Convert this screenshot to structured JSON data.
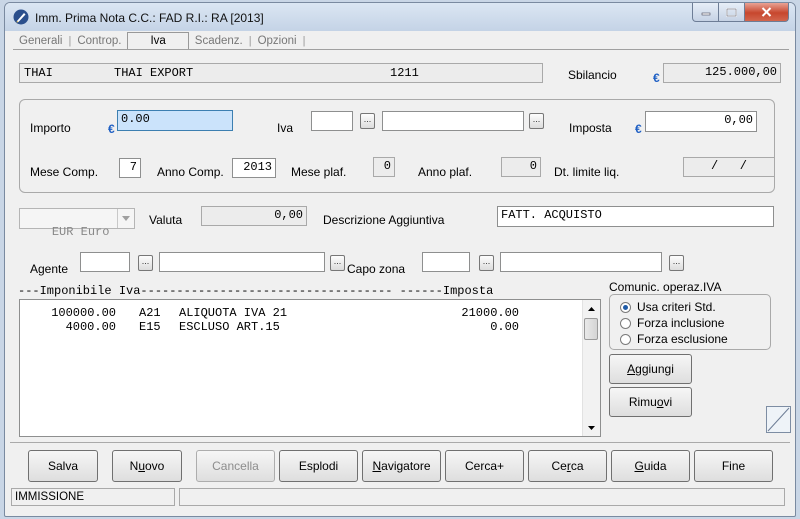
{
  "window": {
    "title": "Imm. Prima Nota C.C.: FAD  R.I.: RA  [2013]",
    "accent": "#1e5fc4",
    "close_color": "#c7472e"
  },
  "tabs": [
    {
      "label": "Generali",
      "active": false
    },
    {
      "label": "Controp.",
      "active": false
    },
    {
      "label": "Iva",
      "active": true
    },
    {
      "label": "Scadenz.",
      "active": false
    },
    {
      "label": "Opzioni",
      "active": false
    }
  ],
  "tab_separator": "|",
  "header": {
    "code": "THAI",
    "name": "THAI EXPORT",
    "number": "1211",
    "sbilancio_label": "Sbilancio",
    "currency_symbol": "€",
    "sbilancio_value": "125.000,00"
  },
  "iva_group": {
    "importo_label": "Importo",
    "importo_value": "0.00",
    "iva_label": "Iva",
    "iva_code": "",
    "iva_desc": "",
    "lookup_glyph": "...",
    "imposta_label": "Imposta",
    "imposta_value": "0,00",
    "mese_comp_label": "Mese Comp.",
    "mese_comp_value": "7",
    "anno_comp_label": "Anno Comp.",
    "anno_comp_value": "2013",
    "mese_plaf_label": "Mese plaf.",
    "mese_plaf_value": "0",
    "anno_plaf_label": "Anno plaf.",
    "anno_plaf_value": "0",
    "dt_limite_label": "Dt. limite liq.",
    "dt_limite_value": "/   /"
  },
  "valuta": {
    "selected": "EUR Euro",
    "label": "Valuta",
    "value": "0,00",
    "desc_label": "Descrizione Aggiuntiva",
    "desc_value": "FATT. ACQUISTO"
  },
  "agente": {
    "label": "Agente",
    "code": "",
    "desc": "",
    "capo_zona_label": "Capo zona",
    "capo_code": "",
    "capo_desc": ""
  },
  "list": {
    "header": "---Imponibile Iva----------------------------------- ------Imposta",
    "rows": [
      {
        "imponibile": "100000.00",
        "code": "A21",
        "desc": "ALIQUOTA IVA 21",
        "imposta": "21000.00"
      },
      {
        "imponibile": "4000.00",
        "code": "E15",
        "desc": "ESCLUSO ART.15",
        "imposta": "0.00"
      }
    ]
  },
  "comunic": {
    "label": "Comunic. operaz.IVA",
    "options": [
      {
        "label": "Usa criteri Std.",
        "selected": true
      },
      {
        "label": "Forza inclusione",
        "selected": false
      },
      {
        "label": "Forza esclusione",
        "selected": false
      }
    ]
  },
  "side_buttons": {
    "add": {
      "label": "Aggiungi",
      "accel": "A",
      "rest": "ggiungi"
    },
    "remove": {
      "label": "Rimuovi",
      "pre": "Rimu",
      "accel": "o",
      "post": "vi"
    }
  },
  "buttons": [
    {
      "label": "Salva",
      "pre": "Salva",
      "accel": "",
      "post": "",
      "enabled": true
    },
    {
      "label": "Nuovo",
      "pre": "N",
      "accel": "u",
      "post": "ovo",
      "enabled": true
    },
    {
      "label": "Cancella",
      "pre": "Cancella",
      "accel": "",
      "post": "",
      "enabled": false
    },
    {
      "label": "Esplodi",
      "pre": "Esplodi",
      "accel": "",
      "post": "",
      "enabled": true
    },
    {
      "label": "Navigatore",
      "pre": "",
      "accel": "N",
      "post": "avigatore",
      "enabled": true
    },
    {
      "label": "Cerca+",
      "pre": "Cerca+",
      "accel": "",
      "post": "",
      "enabled": true
    },
    {
      "label": "Cerca",
      "pre": "Ce",
      "accel": "r",
      "post": "ca",
      "enabled": true
    },
    {
      "label": "Guida",
      "pre": "",
      "accel": "G",
      "post": "uida",
      "enabled": true
    },
    {
      "label": "Fine",
      "pre": "Fine",
      "accel": "",
      "post": "",
      "enabled": true
    }
  ],
  "status": {
    "mode": "IMMISSIONE",
    "message": ""
  }
}
